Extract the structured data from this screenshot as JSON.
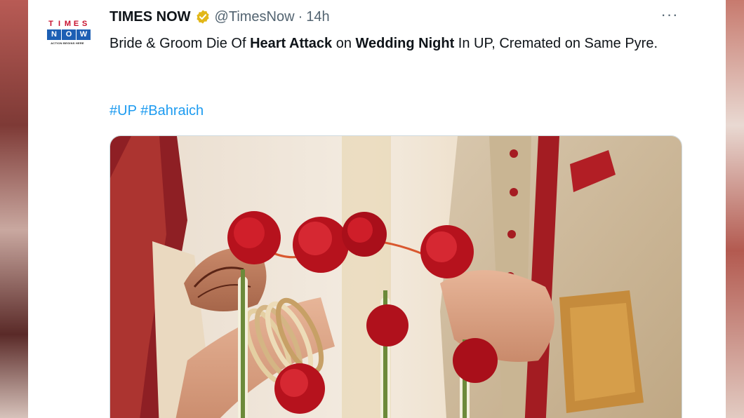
{
  "tweet": {
    "display_name": "TIMES NOW",
    "handle": "@TimesNow",
    "separator": "·",
    "time": "14h",
    "more_label": "···",
    "text_segments": [
      {
        "text": "Bride & Groom Die Of ",
        "bold": false
      },
      {
        "text": "Heart Attack",
        "bold": true
      },
      {
        "text": " on ",
        "bold": false
      },
      {
        "text": "Wedding Night",
        "bold": true
      },
      {
        "text": " In UP, Cremated on Same Pyre.",
        "bold": false
      }
    ],
    "hashtags": [
      "#UP",
      "#Bahraich"
    ]
  },
  "avatar": {
    "logo_line1": [
      "T",
      "I",
      "M",
      "E",
      "S"
    ],
    "logo_line2": [
      "N",
      "O",
      "W"
    ],
    "logo_tagline": "ACTION BEGINS HERE"
  },
  "icons": {
    "verified": "verified-gold-badge-icon",
    "more": "more-options-icon"
  },
  "colors": {
    "link": "#1d9bf0",
    "text": "#0f1419",
    "secondary": "#536471",
    "verified_gold": "#e2b719",
    "logo_red": "#c8102e",
    "logo_blue": "#1d5fb4"
  }
}
